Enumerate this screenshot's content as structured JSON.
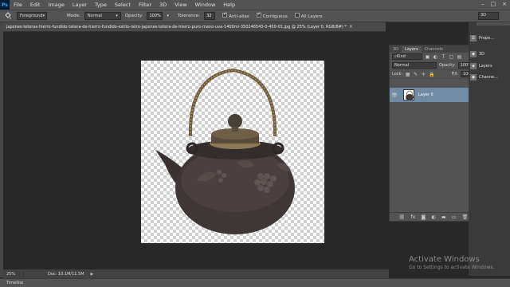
{
  "menubar": {
    "app_icon": "Ps",
    "items": [
      "File",
      "Edit",
      "Image",
      "Layer",
      "Type",
      "Select",
      "Filter",
      "3D",
      "View",
      "Window",
      "Help"
    ],
    "window_controls": [
      "–",
      "□",
      "×"
    ]
  },
  "options": {
    "tool_icon": "paint-bucket-icon",
    "fill_source": "Foreground",
    "mode_label": "Mode:",
    "mode_value": "Normal",
    "opacity_label": "Opacity:",
    "opacity_value": "100%",
    "tolerance_label": "Tolerance:",
    "tolerance_value": "32",
    "antialias_label": "Anti-alias",
    "contiguous_label": "Contiguous",
    "all_layers_label": "All Layers",
    "workspace": "3D"
  },
  "document": {
    "tab_title": "japones-teteras-hierro-fundido-tetera-de-hierro-fundido-estilo-retro-japones-tetera-de-hierro-puro-mano-uva-1400ml-350246543-0-450-01.jpg @ 25% (Layer 0, RGB/8#) *",
    "close": "×"
  },
  "status": {
    "zoom": "25%",
    "doc_size": "Doc: 10.1M/11.5M",
    "arrow": "▶"
  },
  "timeline": {
    "label": "Timeline"
  },
  "layers_panel": {
    "tabs": [
      "3D",
      "Layers",
      "Channels"
    ],
    "menu": "≡",
    "filter_kind": "Kind",
    "blend_mode": "Normal",
    "opacity_label": "Opacity:",
    "opacity_value": "100%",
    "lock_label": "Lock:",
    "fill_label": "Fill:",
    "fill_value": "100%",
    "layers": [
      {
        "name": "Layer 0",
        "visible": true,
        "selected": true
      }
    ],
    "footer_icons": [
      "link-icon",
      "fx-icon",
      "mask-icon",
      "adjustment-icon",
      "folder-icon",
      "new-layer-icon",
      "trash-icon"
    ],
    "footer_glyphs": [
      "⛓",
      "fx",
      "◙",
      "◐",
      "▬",
      "▭",
      "🗑"
    ]
  },
  "side_panels": {
    "items": [
      {
        "icon": "properties-icon",
        "label": "Prope..."
      },
      {
        "icon": "3d-icon",
        "label": "3D"
      },
      {
        "icon": "layers-icon",
        "label": "Layers"
      },
      {
        "icon": "channels-icon",
        "label": "Channe..."
      }
    ]
  },
  "watermark": {
    "title": "Activate Windows",
    "subtitle": "Go to Settings to activate Windows."
  },
  "colors": {
    "selected_layer": "#6f8ba6",
    "panel_bg": "#535353",
    "canvas_bg": "#282828"
  }
}
